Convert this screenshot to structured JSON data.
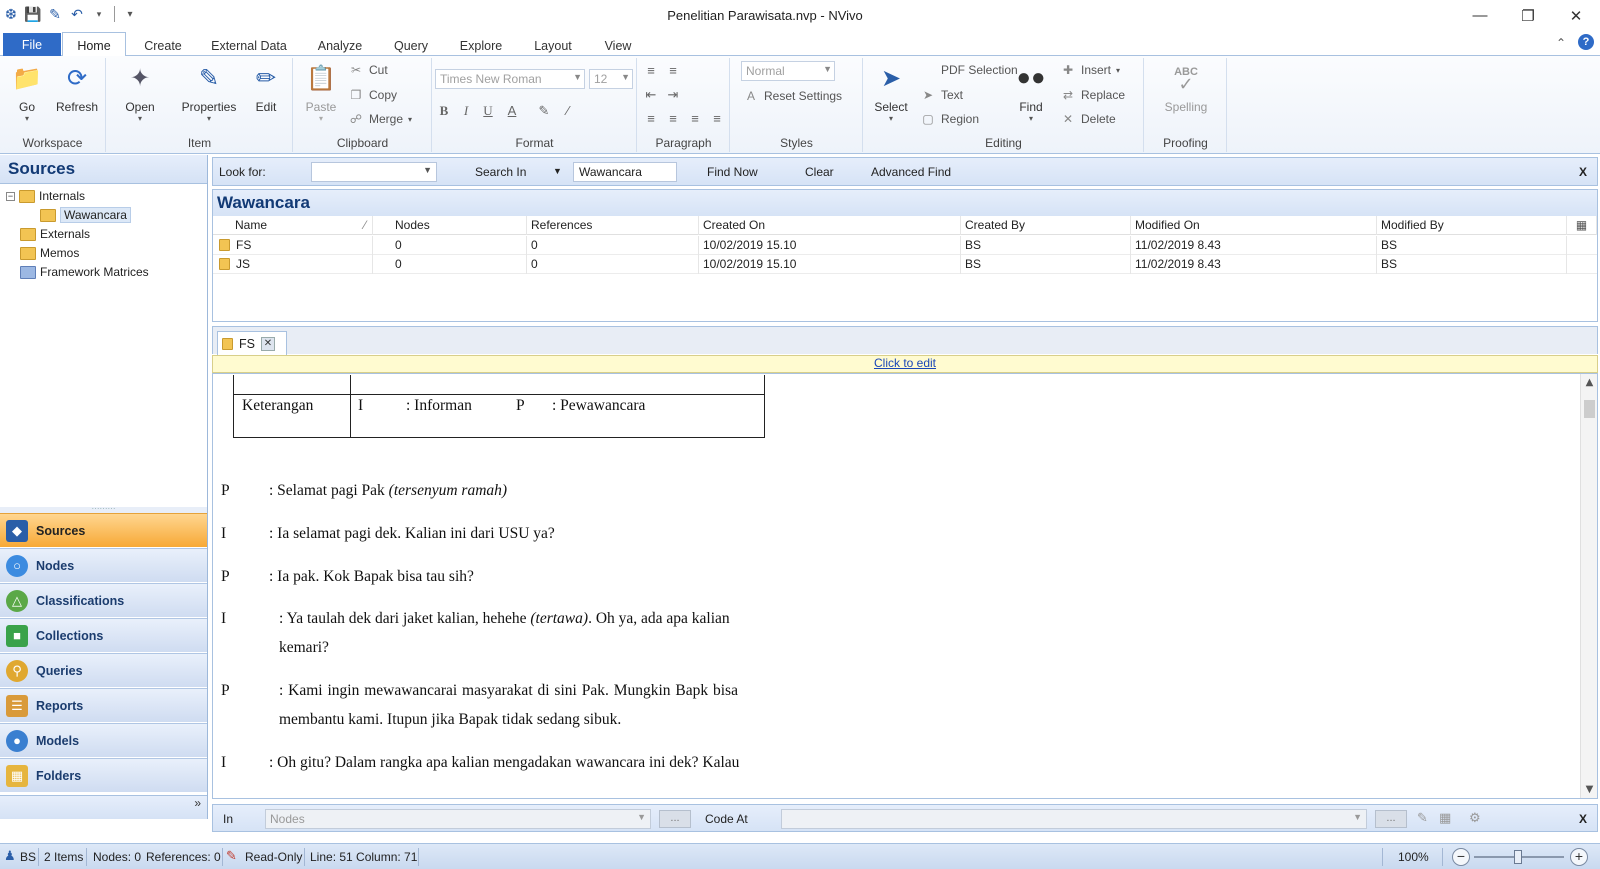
{
  "window": {
    "title": "Penelitian Parawisata.nvp - NVivo",
    "controls": {
      "minimize": "—",
      "restore": "❐",
      "close": "✕"
    }
  },
  "ribbon_tabs": [
    {
      "label": "File"
    },
    {
      "label": "Home"
    },
    {
      "label": "Create"
    },
    {
      "label": "External Data"
    },
    {
      "label": "Analyze"
    },
    {
      "label": "Query"
    },
    {
      "label": "Explore"
    },
    {
      "label": "Layout"
    },
    {
      "label": "View"
    }
  ],
  "ribbon": {
    "workspace": {
      "label": "Workspace",
      "go": "Go",
      "refresh": "Refresh"
    },
    "item": {
      "label": "Item",
      "open": "Open",
      "properties": "Properties",
      "edit": "Edit"
    },
    "clipboard": {
      "label": "Clipboard",
      "paste": "Paste",
      "cut": "Cut",
      "copy": "Copy",
      "merge": "Merge"
    },
    "format": {
      "label": "Format",
      "font": "Times New Roman",
      "size": "12"
    },
    "paragraph": {
      "label": "Paragraph"
    },
    "styles": {
      "label": "Styles",
      "style": "Normal",
      "reset": "Reset Settings"
    },
    "editing": {
      "label": "Editing",
      "select": "Select",
      "pdf_selection": "PDF Selection",
      "text": "Text",
      "region": "Region",
      "find": "Find",
      "insert": "Insert",
      "replace": "Replace",
      "delete": "Delete"
    },
    "proofing": {
      "label": "Proofing",
      "spelling": "Spelling",
      "abc": "ABC"
    }
  },
  "nav": {
    "header": "Sources",
    "tree": [
      {
        "label": "Internals"
      },
      {
        "label": "Wawancara"
      },
      {
        "label": "Externals"
      },
      {
        "label": "Memos"
      },
      {
        "label": "Framework Matrices"
      }
    ],
    "buttons": [
      {
        "label": "Sources"
      },
      {
        "label": "Nodes"
      },
      {
        "label": "Classifications"
      },
      {
        "label": "Collections"
      },
      {
        "label": "Queries"
      },
      {
        "label": "Reports"
      },
      {
        "label": "Models"
      },
      {
        "label": "Folders"
      }
    ],
    "more": "»"
  },
  "findbar": {
    "look_for": "Look for:",
    "look_for_value": "",
    "search_in": "Search In",
    "search_in_value": "Wawancara",
    "find_now": "Find Now",
    "clear": "Clear",
    "advanced_find": "Advanced Find",
    "close": "X"
  },
  "list": {
    "title": "Wawancara",
    "columns": [
      "Name",
      "Nodes",
      "References",
      "Created On",
      "Created By",
      "Modified On",
      "Modified By"
    ],
    "rows": [
      {
        "name": "FS",
        "nodes": "0",
        "references": "0",
        "created_on": "10/02/2019 15.10",
        "created_by": "BS",
        "modified_on": "11/02/2019 8.43",
        "modified_by": "BS"
      },
      {
        "name": "JS",
        "nodes": "0",
        "references": "0",
        "created_on": "10/02/2019 15.10",
        "created_by": "BS",
        "modified_on": "11/02/2019 8.43",
        "modified_by": "BS"
      }
    ]
  },
  "detail": {
    "tab_label": "FS",
    "click_to_edit": "Click to edit",
    "table": {
      "c1": "Keterangan",
      "i": "I",
      "i_desc": ": Informan",
      "p": "P",
      "p_desc": ": Pewawancara"
    },
    "paragraphs": [
      {
        "speaker": "P",
        "text": ": Selamat pagi Pak ",
        "italic": "(tersenyum ramah)",
        "rest": ""
      },
      {
        "speaker": "I",
        "text": ": Ia selamat pagi dek. Kalian ini dari USU ya?",
        "italic": "",
        "rest": ""
      },
      {
        "speaker": "P",
        "text": ": Ia pak. Kok Bapak bisa tau sih?",
        "italic": "",
        "rest": ""
      },
      {
        "speaker": "I",
        "text": ": Ya taulah dek dari jaket kalian, hehehe ",
        "italic": "(tertawa)",
        "rest": ". Oh ya, ada apa kalian",
        "line2": "kemari?"
      },
      {
        "speaker": "P",
        "text": ": Kami ingin mewawancarai masyarakat di sini Pak. Mungkin Bapk bisa",
        "italic": "",
        "rest": "",
        "line2": "membantu kami. Itupun jika Bapak tidak sedang sibuk."
      },
      {
        "speaker": "I",
        "text": ": Oh gitu? Dalam rangka apa kalian mengadakan wawancara ini dek? Kalau",
        "italic": "",
        "rest": ""
      }
    ]
  },
  "codebar": {
    "in": "In",
    "in_value": "Nodes",
    "code_at": "Code At",
    "code_at_value": "",
    "ellipsis": "...",
    "close": "X"
  },
  "status": {
    "user": "BS",
    "items": "2 Items",
    "nodes": "Nodes: 0",
    "references": "References: 0",
    "readonly": "Read-Only",
    "position": "Line: 51  Column: 71",
    "zoom": "100%"
  },
  "colors": {
    "accent": "#2f6bc7",
    "nav_active": "#f7a936",
    "header_text": "#123a75"
  }
}
